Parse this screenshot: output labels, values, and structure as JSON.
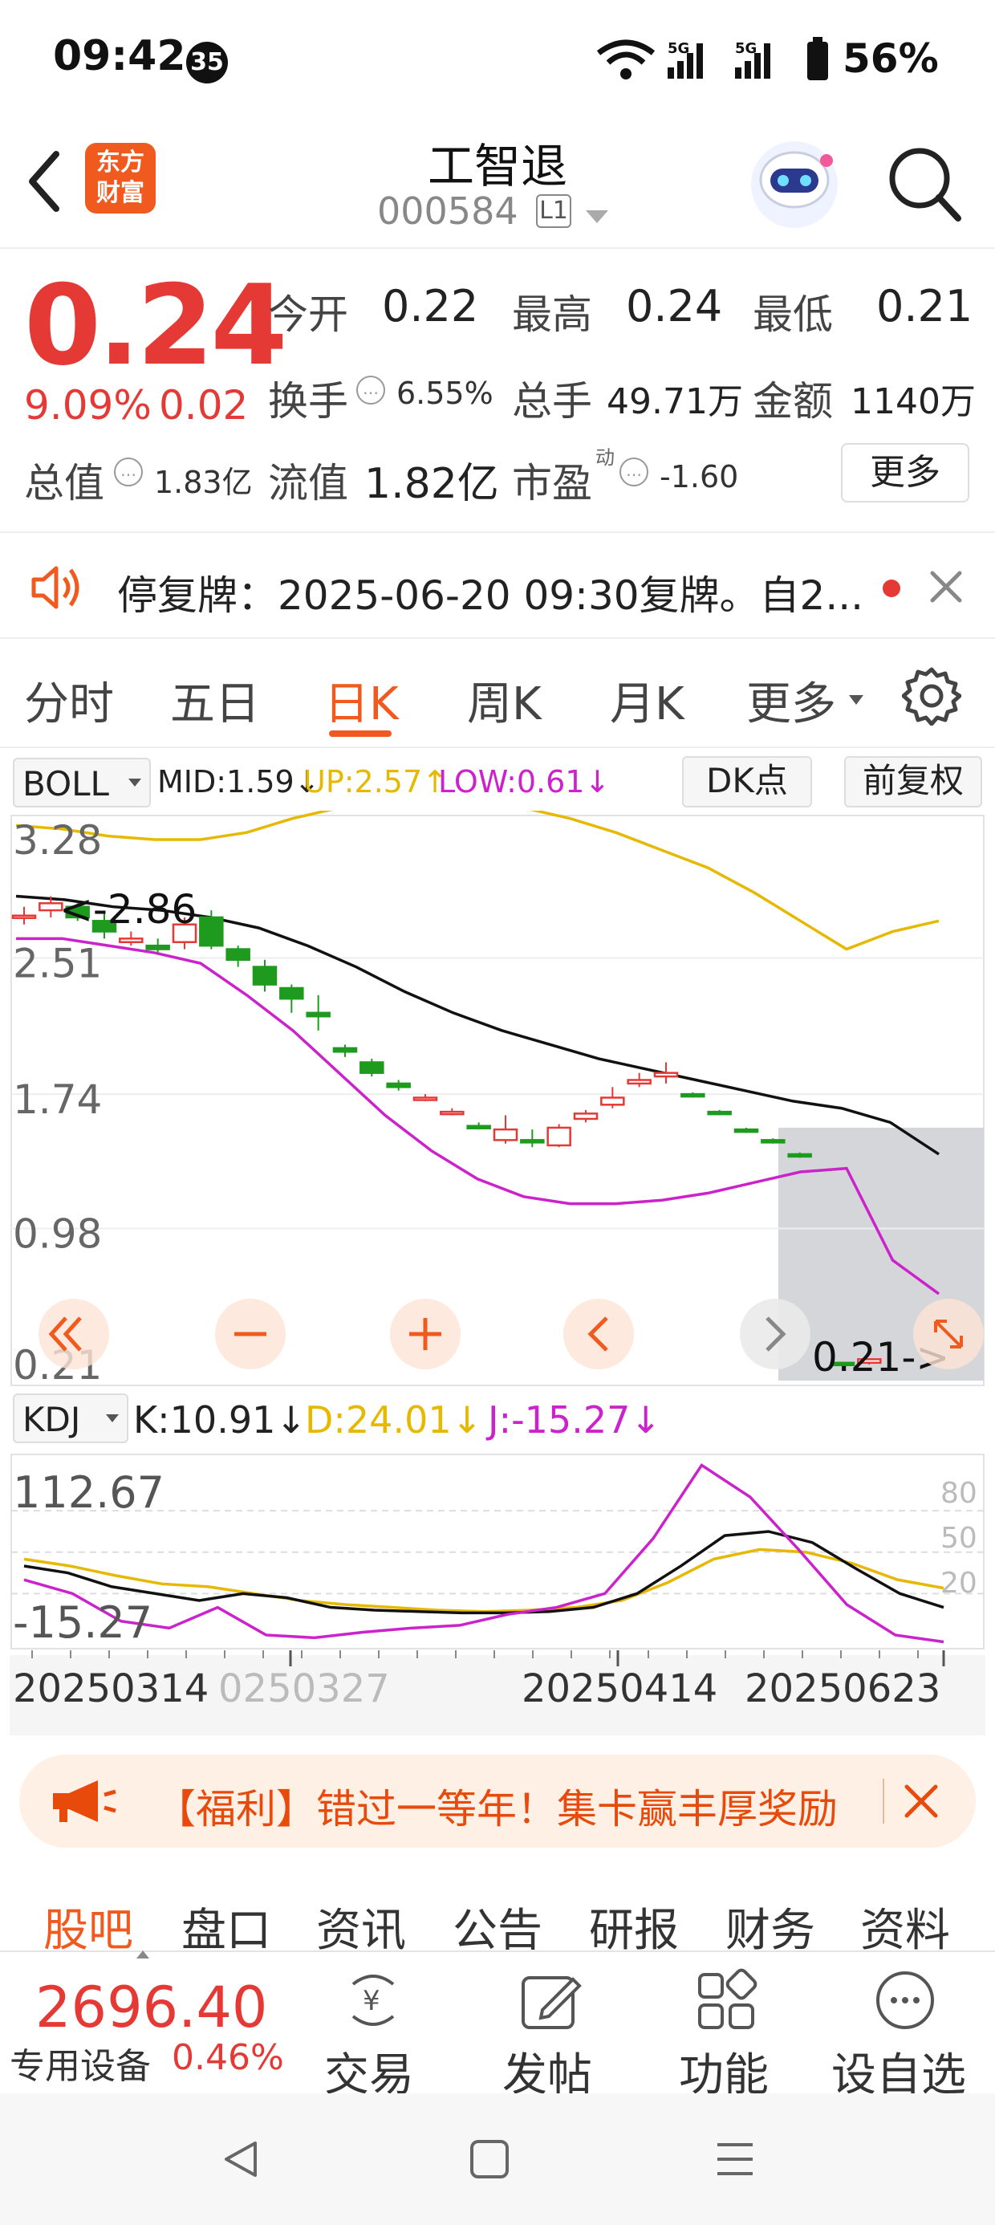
{
  "status_bar": {
    "time": "09:42",
    "badge": "35",
    "battery_percent": "56%",
    "signal_labels": [
      "5G",
      "5G"
    ]
  },
  "header": {
    "app_logo_line1": "东方",
    "app_logo_line2": "财富",
    "stock_name": "工智退",
    "stock_code": "000584",
    "level_badge": "L1",
    "icons": [
      "back-icon",
      "robot-assistant-icon",
      "search-icon"
    ]
  },
  "quote": {
    "price": "0.24",
    "change_pct": "9.09%",
    "change_amt": "0.02",
    "open_label": "今开",
    "open": "0.22",
    "high_label": "最高",
    "high": "0.24",
    "low_label": "最低",
    "low": "0.21",
    "turnover_label": "换手",
    "turnover": "6.55%",
    "volume_label": "总手",
    "volume": "49.71万",
    "amount_label": "金额",
    "amount": "1140万",
    "mktcap_label": "总值",
    "mktcap": "1.83亿",
    "float_label": "流值",
    "float_cap": "1.82亿",
    "pe_label": "市盈",
    "pe_sup": "动",
    "pe": "-1.60",
    "more_label": "更多"
  },
  "notice": {
    "text": "停复牌：2025-06-20 09:30复牌。自2...",
    "icons": [
      "speaker-icon",
      "close-icon"
    ]
  },
  "period_tabs": {
    "items": [
      "分时",
      "五日",
      "日K",
      "周K",
      "月K",
      "更多"
    ],
    "active": "日K"
  },
  "indicator": {
    "name": "BOLL",
    "mid": "MID:1.59↓",
    "up": "UP:2.57↑",
    "low": "LOW:0.61↓",
    "dk_label": "DK点",
    "adjust_label": "前复权"
  },
  "colors": {
    "accent": "#f05a1e",
    "up_red": "#e53935",
    "down_green": "#1e9b1e",
    "boll_up": "#e6b800",
    "boll_low": "#cc22cc",
    "boll_mid": "#111111"
  },
  "chart_data": [
    {
      "type": "candlestick",
      "y_ticks": [
        "3.28",
        "2.51",
        "1.74",
        "0.98",
        "0.21"
      ],
      "ylim": [
        0.21,
        3.28
      ],
      "annotations": [
        "<-2.86",
        "0.21->"
      ],
      "candles": [
        {
          "o": 2.75,
          "c": 2.75,
          "h": 2.8,
          "l": 2.7
        },
        {
          "o": 2.78,
          "c": 2.82,
          "h": 2.86,
          "l": 2.74
        },
        {
          "o": 2.8,
          "c": 2.74,
          "h": 2.82,
          "l": 2.72
        },
        {
          "o": 2.72,
          "c": 2.66,
          "h": 2.76,
          "l": 2.62
        },
        {
          "o": 2.6,
          "c": 2.62,
          "h": 2.66,
          "l": 2.58
        },
        {
          "o": 2.58,
          "c": 2.56,
          "h": 2.62,
          "l": 2.54
        },
        {
          "o": 2.6,
          "c": 2.7,
          "h": 2.74,
          "l": 2.56
        },
        {
          "o": 2.74,
          "c": 2.58,
          "h": 2.78,
          "l": 2.56
        },
        {
          "o": 2.56,
          "c": 2.5,
          "h": 2.58,
          "l": 2.46
        },
        {
          "o": 2.46,
          "c": 2.36,
          "h": 2.5,
          "l": 2.32
        },
        {
          "o": 2.34,
          "c": 2.28,
          "h": 2.36,
          "l": 2.2
        },
        {
          "o": 2.2,
          "c": 2.18,
          "h": 2.3,
          "l": 2.1
        },
        {
          "o": 2.0,
          "c": 1.98,
          "h": 2.02,
          "l": 1.95
        },
        {
          "o": 1.92,
          "c": 1.86,
          "h": 1.94,
          "l": 1.84
        },
        {
          "o": 1.8,
          "c": 1.78,
          "h": 1.82,
          "l": 1.76
        },
        {
          "o": 1.72,
          "c": 1.72,
          "h": 1.74,
          "l": 1.7
        },
        {
          "o": 1.64,
          "c": 1.64,
          "h": 1.66,
          "l": 1.62
        },
        {
          "o": 1.56,
          "c": 1.55,
          "h": 1.58,
          "l": 1.54
        },
        {
          "o": 1.48,
          "c": 1.54,
          "h": 1.62,
          "l": 1.46
        },
        {
          "o": 1.48,
          "c": 1.47,
          "h": 1.54,
          "l": 1.44
        },
        {
          "o": 1.45,
          "c": 1.55,
          "h": 1.57,
          "l": 1.44
        },
        {
          "o": 1.6,
          "c": 1.63,
          "h": 1.65,
          "l": 1.58
        },
        {
          "o": 1.68,
          "c": 1.72,
          "h": 1.78,
          "l": 1.66
        },
        {
          "o": 1.8,
          "c": 1.82,
          "h": 1.86,
          "l": 1.78
        },
        {
          "o": 1.84,
          "c": 1.86,
          "h": 1.92,
          "l": 1.8
        },
        {
          "o": 1.74,
          "c": 1.73,
          "h": 1.75,
          "l": 1.72
        },
        {
          "o": 1.64,
          "c": 1.63,
          "h": 1.65,
          "l": 1.62
        },
        {
          "o": 1.54,
          "c": 1.53,
          "h": 1.55,
          "l": 1.52
        },
        {
          "o": 1.48,
          "c": 1.47,
          "h": 1.49,
          "l": 1.46
        },
        {
          "o": 1.4,
          "c": 1.39,
          "h": 1.41,
          "l": 1.38
        },
        {
          "o": 0.22,
          "c": 0.21,
          "h": 0.22,
          "l": 0.21
        },
        {
          "o": 0.22,
          "c": 0.24,
          "h": 0.24,
          "l": 0.21
        }
      ],
      "boll_up": [
        3.26,
        3.24,
        3.2,
        3.18,
        3.18,
        3.22,
        3.3,
        3.36,
        3.38,
        3.4,
        3.4,
        3.36,
        3.3,
        3.22,
        3.12,
        3.02,
        2.88,
        2.72,
        2.56,
        2.66,
        2.72
      ],
      "boll_mid": [
        2.86,
        2.84,
        2.8,
        2.78,
        2.74,
        2.68,
        2.58,
        2.46,
        2.32,
        2.2,
        2.1,
        2.02,
        1.94,
        1.88,
        1.82,
        1.76,
        1.7,
        1.66,
        1.58,
        1.4
      ],
      "boll_low": [
        2.62,
        2.62,
        2.58,
        2.54,
        2.48,
        2.3,
        2.1,
        1.86,
        1.62,
        1.42,
        1.26,
        1.16,
        1.12,
        1.12,
        1.14,
        1.18,
        1.24,
        1.3,
        1.32,
        0.8,
        0.61
      ]
    },
    {
      "type": "line",
      "title": "KDJ",
      "series_labels": {
        "k": "K:10.91↓",
        "d": "D:24.01↓",
        "j": "J:-15.27↓"
      },
      "y_ticks_left": [
        "112.67",
        "-15.27"
      ],
      "y_ticks_right": [
        "80",
        "50",
        "20"
      ],
      "ylim": [
        -15.27,
        112.67
      ],
      "x_ticks": [
        "20250314",
        "0250327",
        "20250414",
        "20250623"
      ],
      "k": [
        40,
        35,
        25,
        20,
        15,
        20,
        17,
        10,
        8,
        7,
        6,
        6,
        7,
        10,
        20,
        40,
        62,
        65,
        57,
        38,
        20,
        10
      ],
      "d": [
        45,
        40,
        33,
        27,
        25,
        20,
        15,
        12,
        10,
        8,
        7,
        8,
        10,
        15,
        28,
        45,
        52,
        50,
        42,
        30,
        24
      ],
      "j": [
        30,
        20,
        0,
        -5,
        10,
        -10,
        -12,
        -8,
        -5,
        -3,
        5,
        10,
        20,
        60,
        113,
        90,
        52,
        12,
        -10,
        -15
      ]
    }
  ],
  "promo": {
    "text": "【福利】错过一等年！集卡赢丰厚奖励",
    "icons": [
      "megaphone-icon",
      "close-icon"
    ]
  },
  "bottom_tabs": {
    "items": [
      "股吧",
      "盘口",
      "资讯",
      "公告",
      "研报",
      "财务",
      "资料"
    ],
    "active": "股吧"
  },
  "bottom_bar": {
    "index_value": "2696.40",
    "index_name": "专用设备",
    "index_change": "0.46%",
    "actions": [
      "交易",
      "发帖",
      "功能",
      "设自选"
    ]
  }
}
